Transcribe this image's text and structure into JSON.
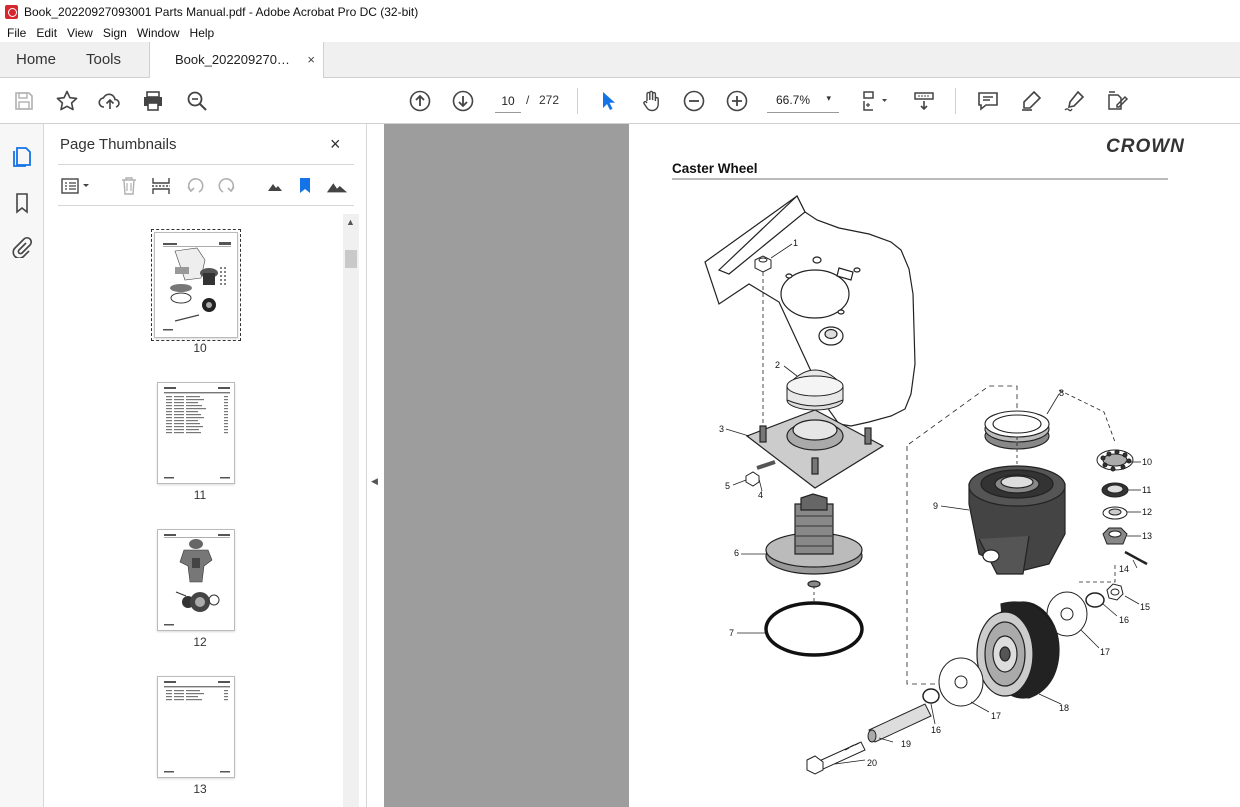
{
  "window": {
    "title": "Book_20220927093001 Parts Manual.pdf - Adobe Acrobat Pro DC (32-bit)"
  },
  "menu": [
    "File",
    "Edit",
    "View",
    "Sign",
    "Window",
    "Help"
  ],
  "tabs": {
    "home": "Home",
    "tools": "Tools",
    "document": "Book_202209270…",
    "close": "×"
  },
  "toolbar": {
    "page_current": "10",
    "page_sep": "/",
    "page_total": "272",
    "zoom": "66.7%",
    "zoom_caret": "▾"
  },
  "thumbnails": {
    "title": "Page Thumbnails",
    "close": "×",
    "pages": [
      "10",
      "11",
      "12",
      "13"
    ],
    "selected": "10"
  },
  "document": {
    "brand": "CROWN",
    "heading": "Caster Wheel",
    "callouts": [
      "1",
      "2",
      "3",
      "4",
      "5",
      "6",
      "7",
      "8",
      "9",
      "10",
      "11",
      "12",
      "13",
      "14",
      "15",
      "16",
      "16",
      "17",
      "17",
      "18",
      "19",
      "20"
    ]
  },
  "colors": {
    "canvas_gray": "#9d9d9d",
    "accent_blue": "#1473e6",
    "app_red": "#d7282f"
  },
  "icons": {
    "rail": [
      "pages-icon",
      "bookmark-icon",
      "attachment-icon"
    ],
    "toolbar": [
      "save-icon",
      "star-icon",
      "upload-icon",
      "print-icon",
      "zoom-search-icon",
      "page-up-icon",
      "page-down-icon",
      "select-arrow-icon",
      "hand-icon",
      "zoom-out-icon",
      "zoom-in-icon",
      "fit-page-icon",
      "scroll-mode-icon",
      "comment-icon",
      "highlight-icon",
      "sign-icon",
      "edit-pdf-icon"
    ]
  }
}
